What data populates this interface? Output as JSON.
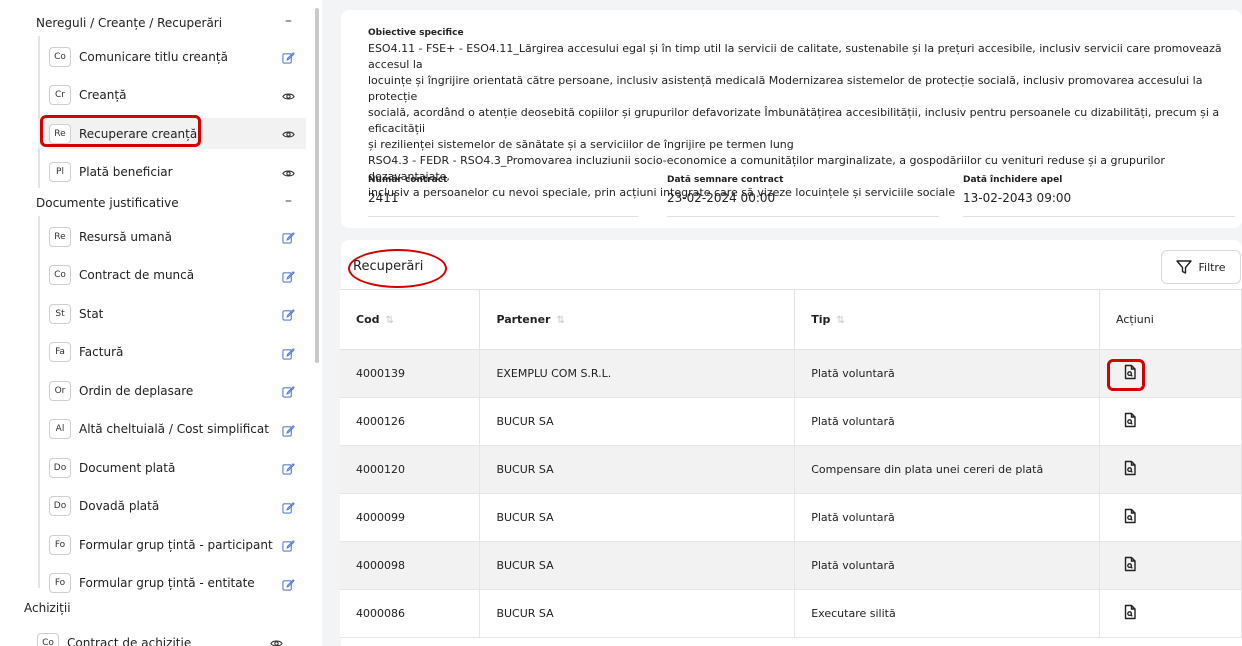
{
  "sidebar": {
    "section_nereguli": "Nereguli / Creanțe / Recuperări",
    "section_documente": "Documente justificative",
    "section_achizitii": "Achiziții",
    "collapse_symbol": "–",
    "nereguli_items": [
      {
        "badge": "Co",
        "label": "Comunicare titlu creanță",
        "icon": "edit-icon"
      },
      {
        "badge": "Cr",
        "label": "Creanță",
        "icon": "view-icon"
      },
      {
        "badge": "Re",
        "label": "Recuperare creanță",
        "icon": "view-icon"
      },
      {
        "badge": "Pl",
        "label": "Plată beneficiar",
        "icon": "view-icon"
      }
    ],
    "documente_items": [
      {
        "badge": "Re",
        "label": "Resursă umană",
        "icon": "edit-icon"
      },
      {
        "badge": "Co",
        "label": "Contract de muncă",
        "icon": "edit-icon"
      },
      {
        "badge": "St",
        "label": "Stat",
        "icon": "edit-icon"
      },
      {
        "badge": "Fa",
        "label": "Factură",
        "icon": "edit-icon"
      },
      {
        "badge": "Or",
        "label": "Ordin de deplasare",
        "icon": "edit-icon"
      },
      {
        "badge": "Al",
        "label": "Altă cheltuială / Cost simplificat",
        "icon": "edit-icon"
      },
      {
        "badge": "Do",
        "label": "Document plată",
        "icon": "edit-icon"
      },
      {
        "badge": "Do",
        "label": "Dovadă plată",
        "icon": "edit-icon"
      },
      {
        "badge": "Fo",
        "label": "Formular grup țintă - participant",
        "icon": "edit-icon"
      },
      {
        "badge": "Fo",
        "label": "Formular grup țintă - entitate",
        "icon": "edit-icon"
      }
    ],
    "achizitii_items": [
      {
        "badge": "Co",
        "label": "Contract de achiziție",
        "icon": "view-icon"
      }
    ]
  },
  "details": {
    "objectives_label": "Obiective specifice",
    "objectives_lines": [
      "ESO4.11 - FSE+ - ESO4.11_Lărgirea accesului egal și în timp util la servicii de calitate, sustenabile și la prețuri accesibile, inclusiv servicii care promovează accesul la",
      "locuințe și îngrijire orientată către persoane, inclusiv asistență medicală Modernizarea sistemelor de protecție socială, inclusiv promovarea accesului la protecție",
      "socială, acordând o atenție deosebită copiilor și grupurilor defavorizate Îmbunătățirea accesibilității, inclusiv pentru persoanele cu dizabilități, precum și a eficacității",
      "și rezilienței sistemelor de sănătate și a serviciilor de îngrijire pe termen lung",
      "RSO4.3 - FEDR - RSO4.3_Promovarea incluziunii socio-economice a comunităților marginalizate, a gospodăriilor cu venituri reduse și a grupurilor dezavantajate,",
      "inclusiv a persoanelor cu nevoi speciale, prin acțiuni integrate care să vizeze locuințele și serviciile sociale"
    ],
    "contract_number_label": "Număr contract",
    "contract_number": "2411",
    "sign_date_label": "Dată semnare contract",
    "sign_date": "23-02-2024 00:00",
    "close_date_label": "Dată închidere apel",
    "close_date": "13-02-2043 09:00"
  },
  "recuperari": {
    "title": "Recuperări",
    "filter_label": "Filtre",
    "columns": {
      "cod": "Cod",
      "partener": "Partener",
      "tip": "Tip",
      "actiuni": "Acțiuni"
    },
    "rows": [
      {
        "cod": "4000139",
        "partener": "EXEMPLU COM S.R.L.",
        "tip": "Plată voluntară"
      },
      {
        "cod": "4000126",
        "partener": "BUCUR SA",
        "tip": "Plată voluntară"
      },
      {
        "cod": "4000120",
        "partener": "BUCUR SA",
        "tip": "Compensare din plata unei cereri de plată"
      },
      {
        "cod": "4000099",
        "partener": "BUCUR SA",
        "tip": "Plată voluntară"
      },
      {
        "cod": "4000098",
        "partener": "BUCUR SA",
        "tip": "Plată voluntară"
      },
      {
        "cod": "4000086",
        "partener": "BUCUR SA",
        "tip": "Executare silită"
      }
    ]
  },
  "colors": {
    "highlight": "#d40000",
    "row_alt": "#f2f2f2",
    "page_bg": "#f3f4f6"
  }
}
